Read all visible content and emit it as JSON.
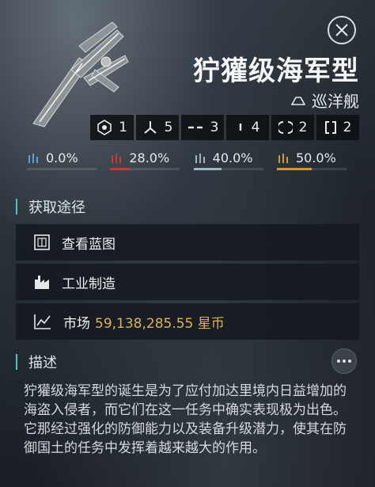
{
  "header": {
    "ship_name": "狞獾级海军型",
    "ship_class": "巡洋舰"
  },
  "slots": [
    {
      "icon": "high-slot-icon",
      "count": "1"
    },
    {
      "icon": "turret-hardpoint-icon",
      "count": "5"
    },
    {
      "icon": "medium-slot-icon",
      "count": "3"
    },
    {
      "icon": "low-slot-icon",
      "count": "4"
    },
    {
      "icon": "rig-slot-icon",
      "count": "2"
    },
    {
      "icon": "subsystem-icon",
      "count": "2"
    }
  ],
  "resists": [
    {
      "icon": "em-resist-icon",
      "value": "0.0%",
      "fraction": 0.0,
      "color": "#5aa0d8"
    },
    {
      "icon": "thermal-resist-icon",
      "value": "28.0%",
      "fraction": 0.28,
      "color": "#c83a3a"
    },
    {
      "icon": "kinetic-resist-icon",
      "value": "40.0%",
      "fraction": 0.4,
      "color": "#9fb4c2"
    },
    {
      "icon": "explosive-resist-icon",
      "value": "50.0%",
      "fraction": 0.5,
      "color": "#c99a3a"
    }
  ],
  "acquire": {
    "title": "获取途径",
    "blueprint_label": "查看蓝图",
    "manufacture_label": "工业制造",
    "market_label": "市场",
    "market_price": "59,138,285.55 星币"
  },
  "description": {
    "title": "描述",
    "text": "狞獾级海军型的诞生是为了应付加达里境内日益增加的海盗入侵者，而它们在这一任务中确实表现极为出色。它那经过强化的防御能力以及装备升级潜力，使其在防御国土的任务中发挥着越来越大的作用。"
  },
  "colors": {
    "accent": "#52c0c4",
    "price": "#d9b25a"
  }
}
